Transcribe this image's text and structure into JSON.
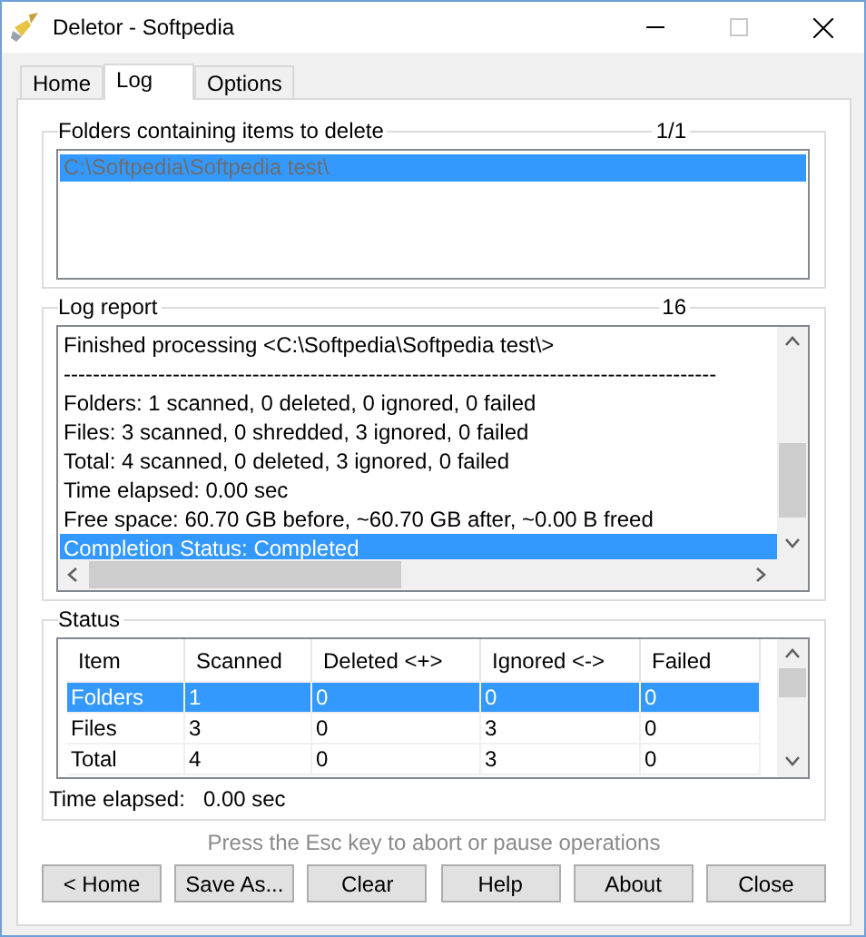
{
  "window": {
    "title": "Deletor - Softpedia",
    "maximize_disabled": true
  },
  "tabs": [
    {
      "label": "Home",
      "selected": false
    },
    {
      "label": "Log",
      "selected": true
    },
    {
      "label": "Options",
      "selected": false
    }
  ],
  "folders_group": {
    "title": "Folders containing items to delete",
    "counter": "1/1",
    "items": [
      {
        "text": "C:\\Softpedia\\Softpedia test\\",
        "selected": true
      }
    ]
  },
  "log_report": {
    "title": "Log report",
    "counter": "16",
    "lines": [
      {
        "text": "Finished processing <C:\\Softpedia\\Softpedia test\\>",
        "selected": false
      },
      {
        "text": "------------------------------------------------------------------------------------------",
        "selected": false
      },
      {
        "text": "Folders: 1 scanned, 0 deleted, 0 ignored, 0 failed",
        "selected": false
      },
      {
        "text": "Files: 3 scanned, 0 shredded, 3 ignored, 0 failed",
        "selected": false
      },
      {
        "text": "Total: 4 scanned, 0 deleted, 3 ignored, 0 failed",
        "selected": false
      },
      {
        "text": "Time elapsed: 0.00 sec",
        "selected": false
      },
      {
        "text": "Free space: 60.70 GB before, ~60.70 GB after, ~0.00 B freed",
        "selected": false
      },
      {
        "text": "Completion Status: Completed",
        "selected": true
      }
    ]
  },
  "status": {
    "title": "Status",
    "columns": [
      "Item",
      "Scanned",
      "Deleted <+>",
      "Ignored <->",
      "Failed"
    ],
    "rows": [
      {
        "cells": [
          "Folders",
          "1",
          "0",
          "0",
          "0"
        ],
        "selected": true
      },
      {
        "cells": [
          "Files",
          "3",
          "0",
          "3",
          "0"
        ],
        "selected": false
      },
      {
        "cells": [
          "Total",
          "4",
          "0",
          "3",
          "0"
        ],
        "selected": false
      }
    ],
    "time_label": "Time elapsed:",
    "time_value": "0.00 sec"
  },
  "hint": "Press the Esc key to abort or pause operations",
  "buttons": [
    "< Home",
    "Save As...",
    "Clear",
    "Help",
    "About",
    "Close"
  ]
}
